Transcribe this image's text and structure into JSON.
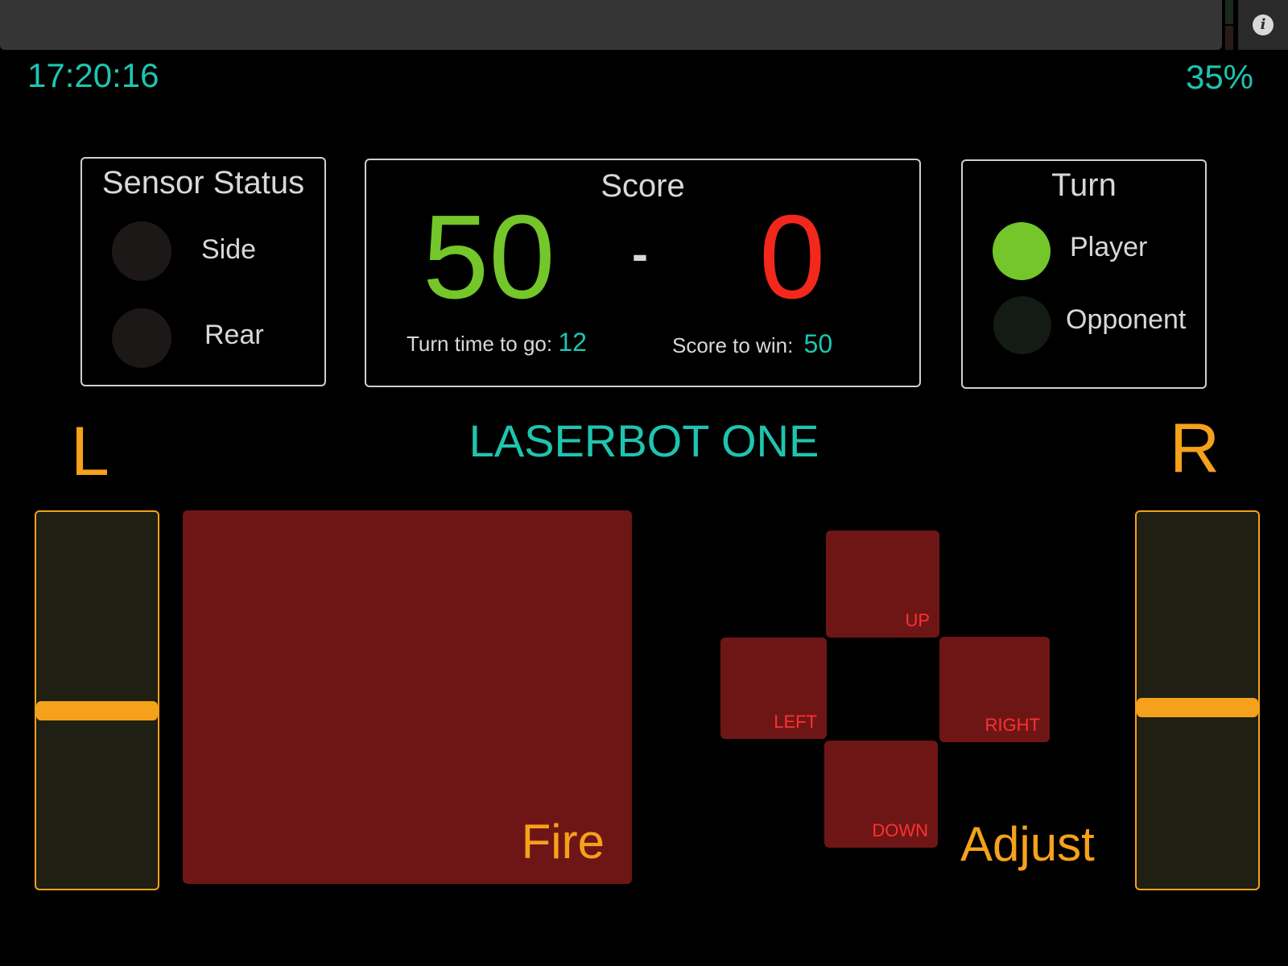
{
  "status": {
    "clock": "17:20:16",
    "battery": "35%",
    "info_icon": "info-icon"
  },
  "sensor_status": {
    "title": "Sensor Status",
    "items": [
      {
        "label": "Side",
        "active": false
      },
      {
        "label": "Rear",
        "active": false
      }
    ]
  },
  "score": {
    "title": "Score",
    "player": "50",
    "separator": "-",
    "opponent": "0",
    "turn_time_label": "Turn time to go:",
    "turn_time_value": "12",
    "score_to_win_label": "Score to win:",
    "score_to_win_value": "50"
  },
  "turn": {
    "title": "Turn",
    "player_label": "Player",
    "opponent_label": "Opponent",
    "current": "Player"
  },
  "title": "LASERBOT ONE",
  "controls": {
    "left_label": "L",
    "right_label": "R",
    "left_throttle_level": 0.53,
    "right_throttle_level": 0.52,
    "fire_label": "Fire",
    "adjust_label": "Adjust",
    "dpad": {
      "up": "UP",
      "left": "LEFT",
      "right": "RIGHT",
      "down": "DOWN"
    }
  },
  "colors": {
    "accent": "#1fc4b0",
    "orange": "#f5a11b",
    "player_green": "#74c62a",
    "opponent_red": "#f2281c",
    "button_red": "#6e1616"
  }
}
